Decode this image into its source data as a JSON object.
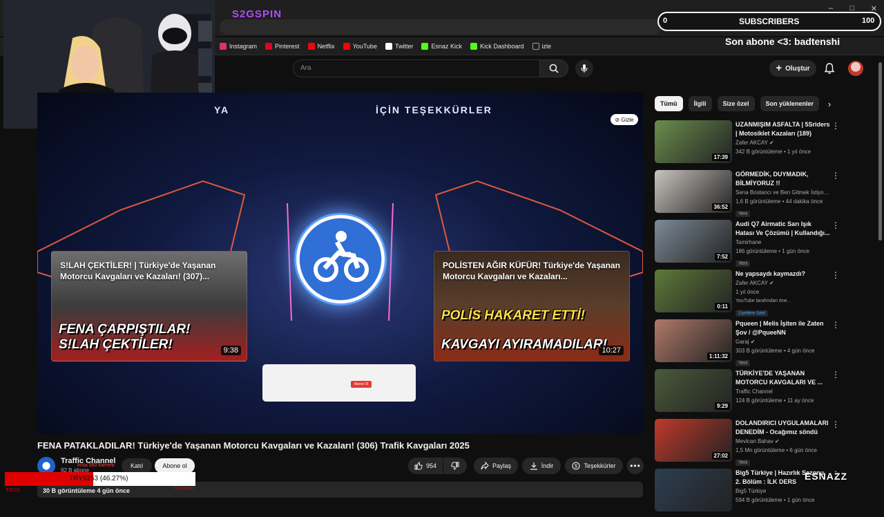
{
  "browser": {
    "tabs_logo": "S2GSPIN",
    "window_buttons": [
      "–",
      "□",
      "✕"
    ],
    "bookmarks": [
      {
        "label": "Instagram",
        "color": "#e1306c"
      },
      {
        "label": "Pinterest",
        "color": "#e60023"
      },
      {
        "label": "Netflix",
        "color": "#e50914"
      },
      {
        "label": "YouTube",
        "color": "#ff0000"
      },
      {
        "label": "Twitter",
        "color": "#ffffff"
      },
      {
        "label": "Esnaz Kick",
        "color": "#53fc18"
      },
      {
        "label": "Kick Dashboard",
        "color": "#53fc18"
      },
      {
        "label": "izle",
        "color": "#9aa0a6"
      }
    ]
  },
  "header": {
    "search_placeholder": "Ara",
    "create_label": "Oluştur"
  },
  "stream_overlay": {
    "subscribers_left": "0",
    "subscribers_title": "SUBSCRIBERS",
    "subscribers_right": "100",
    "last_subscriber": "Son abone <3: badtenshi",
    "goal_text": "TRY9253 (46.27%)",
    "goal_progress": 0.4627,
    "goal_start": "TRY0",
    "goal_end": "TRY20000",
    "cam_overlay_text": "insta 360 kamera",
    "watermark": "ESNAZZ"
  },
  "player": {
    "end_screen_left": "YA",
    "end_screen_right": "İÇİN TEŞEKKÜRLER",
    "hide_label": "Gizle",
    "left_card": {
      "title": "S!LAH ÇEKTİLER! | Türkiye'de Yaşanan Motorcu Kavgaları ve Kazaları! (307)...",
      "big_line1": "FENA ÇARPIŞTILAR!",
      "big_line2": "S!LAH ÇEKTİLER!",
      "duration": "9:38"
    },
    "right_card": {
      "title": "POLİSTEN AĞIR KÜFÜR! Türkiye'de Yaşanan Motorcu Kavgaları ve Kazaları...",
      "big_line1": "POLİS HAKARET ETTİ!",
      "big_line2": "KAVGAYI AYIRAMADILAR!",
      "duration": "10:27"
    },
    "subscribe_card_label": "Abone Ol"
  },
  "video": {
    "title": "FENA PATAKLADILAR! Türkiye'de Yaşanan Motorcu Kavgaları ve Kazaları! (306) Trafik Kavgaları 2025",
    "channel_name": "Traffic Channel",
    "channel_subs": "92 B abone",
    "join_label": "Katıl",
    "subscribe_label": "Abone ol",
    "likes": "954",
    "share_label": "Paylaş",
    "download_label": "İndir",
    "thanks_label": "Teşekkürler",
    "views_line": "30 B görüntüleme  4 gün önce"
  },
  "chips": [
    "Tümü",
    "İlgili",
    "Size özel",
    "Son yüklenenler"
  ],
  "recommendations": [
    {
      "title": "UZANMIŞIM ASFALTA | 5Sriders | Motosiklet Kazaları (189)",
      "channel": "Zafer AKCAY ✔",
      "meta": "342 B görüntüleme • 1 yıl önce",
      "duration": "17:39",
      "badge": "",
      "thumb_color": "#6b8e4e"
    },
    {
      "title": "GÖRMEDİK, DUYMADIK, BİLMİYORUZ !!",
      "channel": "Sena Bostancı ve Ben Gitmek İstiyorum ✔",
      "meta": "1,6 B görüntüleme • 44 dakika önce",
      "duration": "36:52",
      "badge": "Yeni",
      "thumb_color": "#c9c4be"
    },
    {
      "title": "Audi Q7 Airmatic Sarı Işık Hatası Ve Çözümü | Kullandığı...",
      "channel": "Tamirhane",
      "meta": "186 görüntüleme • 1 gün önce",
      "duration": "7:52",
      "badge": "Yeni",
      "thumb_color": "#7d8a96"
    },
    {
      "title": "Ne yapsaydı kaymazdı?",
      "channel": "Zafer AKCAY ✔",
      "meta": "1 yıl önce",
      "duration": "0:11",
      "badge": "",
      "extra": "YouTube tarafından öne...",
      "members": "Üyelere özel",
      "thumb_color": "#5e7a3a"
    },
    {
      "title": "Pqueen | Melis İşiten ile Zaten Şov / @PqueeNN",
      "channel": "Garaj ✔",
      "meta": "303 B görüntüleme • 4 gün önce",
      "duration": "1:11:32",
      "badge": "Yeni",
      "thumb_color": "#b07a6a"
    },
    {
      "title": "TÜRKİYE'DE YAŞANAN MOTORCU KAVGALARI VE ...",
      "channel": "Traffic Channel",
      "meta": "124 B görüntüleme • 11 ay önce",
      "duration": "9:29",
      "badge": "",
      "thumb_color": "#4a5a3a"
    },
    {
      "title": "DOLANDIRICI UYGULAMALARI DENEDİM - Ocağımız söndü",
      "channel": "Mevlcan Bahav ✔",
      "meta": "1,5 Mn görüntüleme • 6 gün önce",
      "duration": "27:02",
      "badge": "Yeni",
      "thumb_color": "#c0392b"
    },
    {
      "title": "Big5 Türkiye | Hazırlık Sezonu 2. Bölüm : İLK DERS",
      "channel": "Big5 Türkiye",
      "meta": "594 B görüntüleme • 1 gün önce",
      "duration": "",
      "badge": "",
      "thumb_color": "#2c3e50"
    }
  ]
}
